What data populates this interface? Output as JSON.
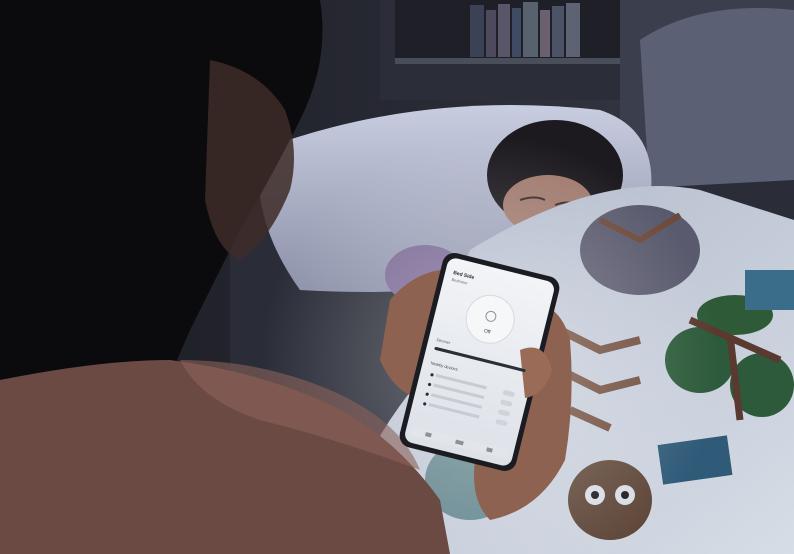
{
  "phone_app": {
    "device_name": "Bed Side",
    "device_room": "Bedroom",
    "power_state": "Off",
    "brightness_label": "Dimmer",
    "section_title": "Nearby devices",
    "list_items": [
      "",
      "",
      "",
      ""
    ]
  },
  "colors": {
    "room_dark": "#15151b",
    "pillow": "#bfc3d6",
    "blanket": "#cfd6e0",
    "leaf_green": "#2c5a3a",
    "leaf_blue": "#2f5a78",
    "screen": "#e9ecf1",
    "sweater": "#6b4a44"
  }
}
